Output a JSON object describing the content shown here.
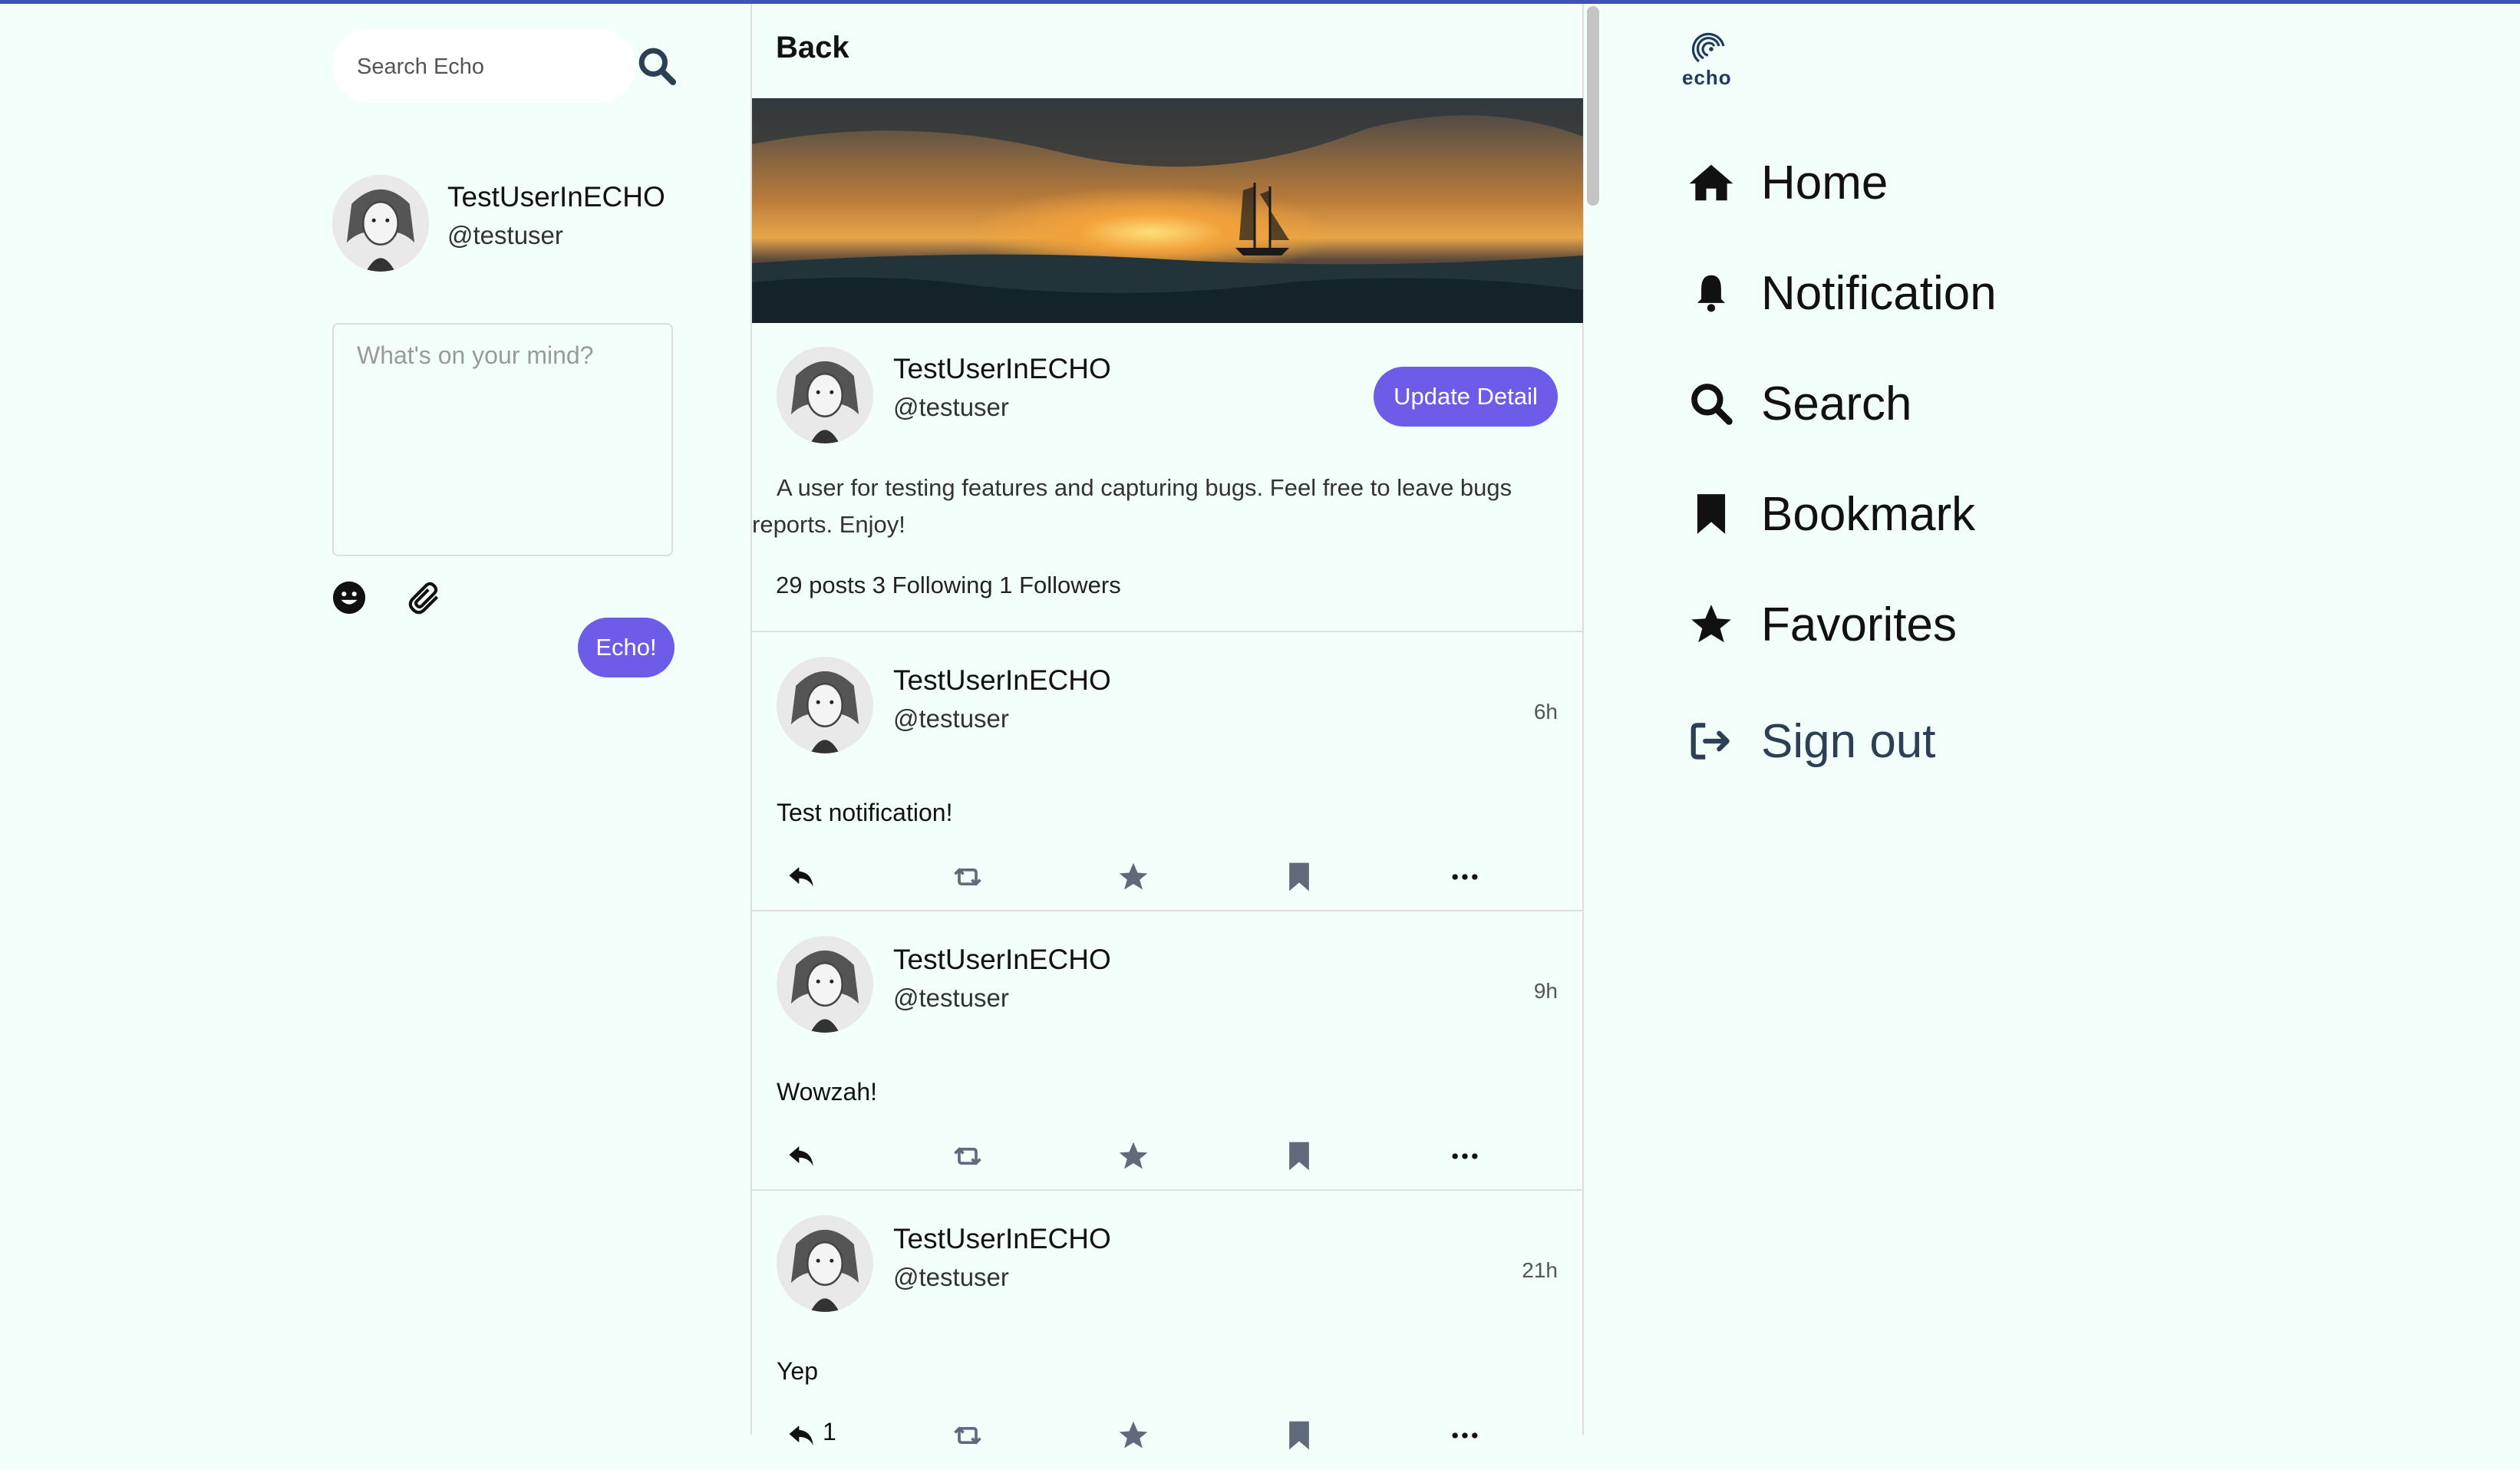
{
  "search": {
    "placeholder": "Search Echo"
  },
  "current_user": {
    "name": "TestUserInECHO",
    "handle": "@testuser"
  },
  "composer": {
    "placeholder": "What's on your mind?",
    "submit_label": "Echo!"
  },
  "profile": {
    "back_label": "Back",
    "name": "TestUserInECHO",
    "handle": "@testuser",
    "update_label": "Update Detail",
    "bio": "A user for testing features and capturing bugs. Feel free to leave bugs reports. Enjoy!",
    "stats": "29 posts 3 Following 1 Followers"
  },
  "posts": [
    {
      "name": "TestUserInECHO",
      "handle": "@testuser",
      "time": "6h",
      "text": "Test notification!",
      "reply_count": ""
    },
    {
      "name": "TestUserInECHO",
      "handle": "@testuser",
      "time": "9h",
      "text": "Wowzah!",
      "reply_count": ""
    },
    {
      "name": "TestUserInECHO",
      "handle": "@testuser",
      "time": "21h",
      "text": "Yep",
      "reply_count": "1"
    }
  ],
  "nav": {
    "logo_text": "echo",
    "items": [
      {
        "label": "Home",
        "icon": "home-icon"
      },
      {
        "label": "Notification",
        "icon": "bell-icon"
      },
      {
        "label": "Search",
        "icon": "search-icon"
      },
      {
        "label": "Bookmark",
        "icon": "bookmark-icon"
      },
      {
        "label": "Favorites",
        "icon": "star-icon"
      },
      {
        "label": "Sign out",
        "icon": "sign-out-icon"
      }
    ]
  },
  "colors": {
    "accent": "#6c5ce7",
    "background": "#f3fffa",
    "top_bar": "#3f51b5",
    "action_icon": "#5f6b7a"
  }
}
